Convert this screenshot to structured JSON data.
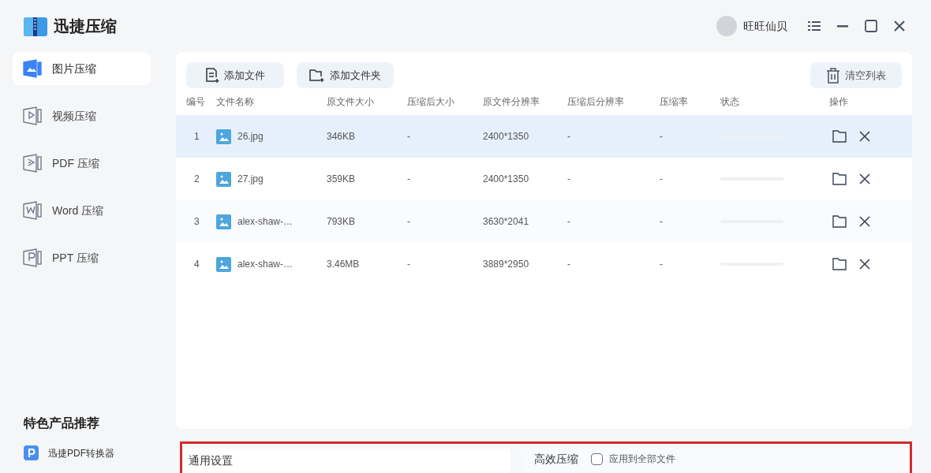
{
  "app": {
    "title": "迅捷压缩",
    "user": "旺旺仙贝"
  },
  "sidebar": {
    "items": [
      {
        "label": "图片压缩",
        "kind": "image",
        "selected": true
      },
      {
        "label": "视频压缩",
        "kind": "video",
        "selected": false
      },
      {
        "label": "PDF 压缩",
        "kind": "pdf",
        "selected": false
      },
      {
        "label": "Word 压缩",
        "kind": "word",
        "selected": false
      },
      {
        "label": "PPT 压缩",
        "kind": "ppt",
        "selected": false
      }
    ],
    "promo_title": "特色产品推荐",
    "promo_items": [
      "迅捷PDF转换器"
    ]
  },
  "toolbar": {
    "add_file": "添加文件",
    "add_folder": "添加文件夹",
    "clear": "清空列表"
  },
  "table": {
    "columns": [
      "编号",
      "文件名称",
      "原文件大小",
      "压缩后大小",
      "原文件分辨率",
      "压缩后分辨率",
      "压缩率",
      "状态",
      "操作"
    ],
    "rows": [
      {
        "index": "1",
        "name": "26.jpg",
        "size": "346KB",
        "compressed_size": "-",
        "resolution": "2400*1350",
        "compressed_resolution": "-",
        "ratio": "-",
        "selected": true
      },
      {
        "index": "2",
        "name": "27.jpg",
        "size": "359KB",
        "compressed_size": "-",
        "resolution": "2400*1350",
        "compressed_resolution": "-",
        "ratio": "-",
        "selected": false
      },
      {
        "index": "3",
        "name": "alex-shaw-…",
        "size": "793KB",
        "compressed_size": "-",
        "resolution": "3630*2041",
        "compressed_resolution": "-",
        "ratio": "-",
        "selected": false
      },
      {
        "index": "4",
        "name": "alex-shaw-…",
        "size": "3.46MB",
        "compressed_size": "-",
        "resolution": "3889*2950",
        "compressed_resolution": "-",
        "ratio": "-",
        "selected": false
      }
    ]
  },
  "settings": {
    "general_title": "通用设置",
    "efficient_title": "高效压缩",
    "apply_all": {
      "label": "应用到全部文件",
      "checked": false
    }
  }
}
